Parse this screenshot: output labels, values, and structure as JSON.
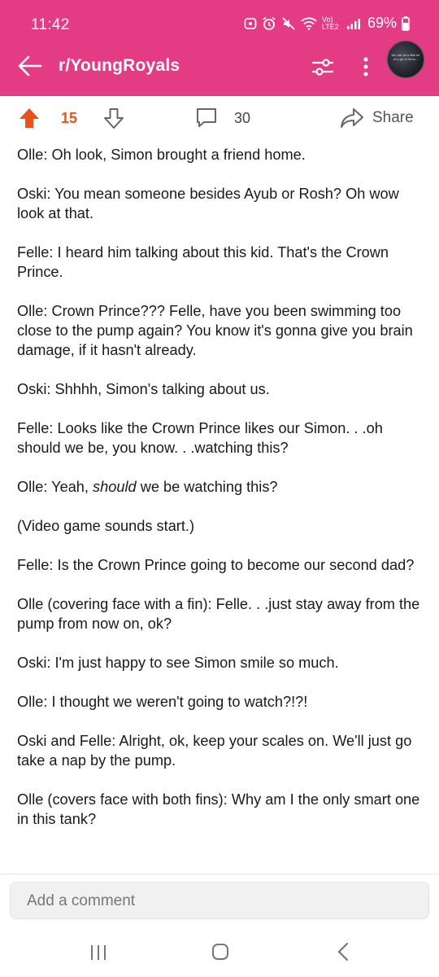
{
  "status_bar": {
    "time": "11:42",
    "network_label": "Vo) LTE2",
    "battery": "69%"
  },
  "app_bar": {
    "subreddit": "r/YoungRoyals",
    "back_icon": "arrow-left-icon",
    "filter_icon": "sliders-icon",
    "more_icon": "more-vertical-icon",
    "avatar_text": "We are all a little bit of a go of Sims..."
  },
  "vote_bar": {
    "score": "15",
    "comments": "30",
    "share_label": "Share",
    "upvote_color": "#e8501c"
  },
  "post": {
    "paragraphs": [
      "Olle: Oh look, Simon brought a friend home.",
      "Oski: You mean someone besides Ayub or Rosh? Oh wow look at that.",
      "Felle: I heard him talking about this kid. That's the Crown Prince.",
      "Olle: Crown Prince??? Felle, have you been swimming too close to the pump again? You know it's gonna give you brain damage, if it hasn't already.",
      "Oski: Shhhh, Simon's talking about us.",
      "Felle: Looks like the Crown Prince likes our Simon. . .oh should we be, you know. . .watching this?",
      "(Video game sounds start.)",
      "Felle: Is the Crown Prince going to become our second dad?",
      "Olle (covering face with a fin): Felle. . .just stay away from the pump from now on, ok?",
      "Oski: I'm just happy to see Simon smile so much.",
      "Olle: I thought we weren't going to watch?!?!",
      "Oski and Felle: Alright, ok, keep your scales on. We'll just go take a nap by the pump.",
      "Olle (covers face with both fins): Why am I the only smart one in this tank?"
    ],
    "italic_line": {
      "before": "Olle: Yeah, ",
      "emphasis": "should",
      "after": " we be watching this?"
    }
  },
  "comment_box": {
    "placeholder": "Add a comment"
  },
  "colors": {
    "header": "#e33b84",
    "accent": "#e8501c"
  }
}
